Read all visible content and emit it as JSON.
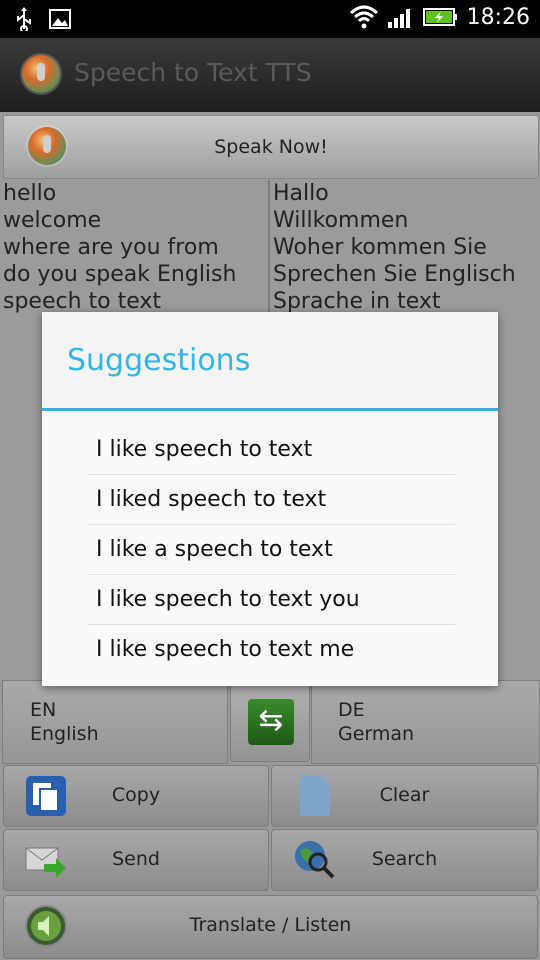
{
  "status_bar": {
    "time": "18:26",
    "icons": [
      "usb-icon",
      "image-icon",
      "wifi-icon",
      "signal-icon",
      "battery-charging-icon"
    ]
  },
  "app": {
    "title": "Speech to Text TTS"
  },
  "speak_button": {
    "label": "Speak Now!"
  },
  "source_lines": [
    "hello",
    "welcome",
    "where are you from",
    "do you speak English",
    "speech to text"
  ],
  "target_lines": [
    "Hallo",
    "Willkommen",
    "Woher kommen Sie",
    "Sprechen Sie Englisch",
    "Sprache in text"
  ],
  "languages": {
    "source": {
      "code": "EN",
      "name": "English"
    },
    "target": {
      "code": "DE",
      "name": "German"
    }
  },
  "actions": {
    "copy": "Copy",
    "clear": "Clear",
    "send": "Send",
    "search": "Search",
    "translate_listen": "Translate / Listen"
  },
  "dialog": {
    "title": "Suggestions",
    "items": [
      "I like speech to text",
      "I liked speech to text",
      "I like a speech to text",
      "I like speech to text you",
      "I like speech to text me"
    ]
  },
  "colors": {
    "accent": "#33b5e5",
    "background": "#9a9a9a",
    "title_text": "#5a5a5a"
  }
}
